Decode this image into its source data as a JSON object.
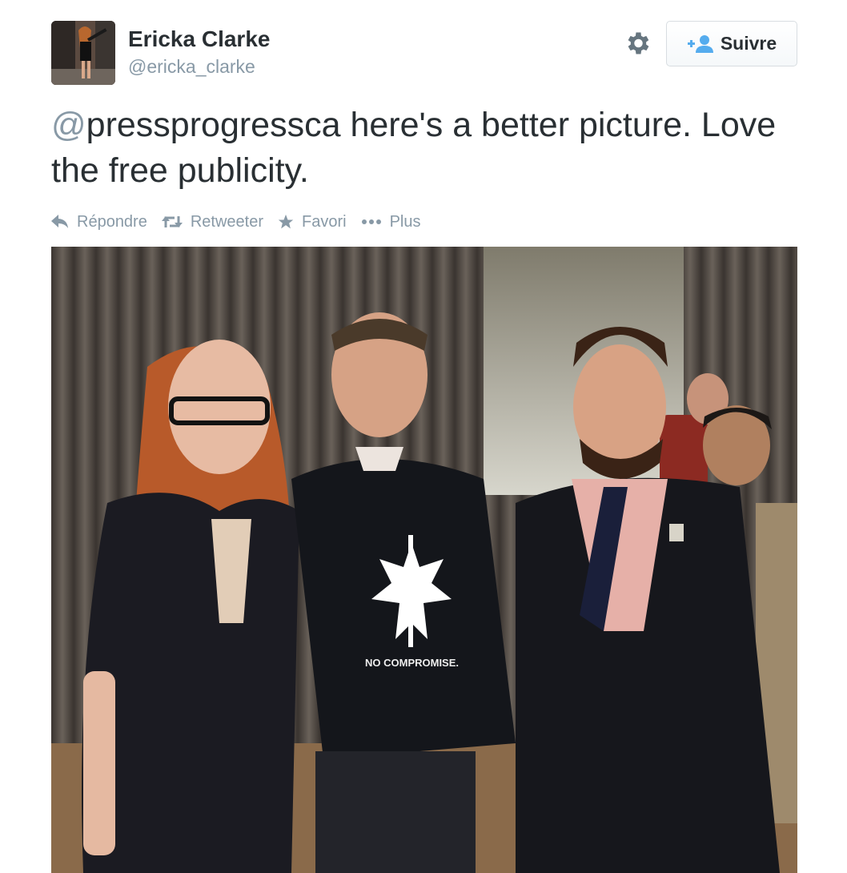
{
  "author": {
    "name": "Ericka Clarke",
    "handle": "@ericka_clarke"
  },
  "follow_button": {
    "label": "Suivre"
  },
  "tweet": {
    "mention_at": "@",
    "mention_name": "pressprogressca",
    "text_rest": " here's a better picture. Love the free publicity."
  },
  "actions": {
    "reply": "Répondre",
    "retweet": "Retweeter",
    "favorite": "Favori",
    "more": "Plus"
  },
  "photo": {
    "shirt_text": "NO COMPROMISE."
  },
  "colors": {
    "text": "#292f33",
    "muted": "#8899a6",
    "follow_icon": "#55acee"
  },
  "icons": {
    "settings": "gear-icon",
    "follow": "add-user-icon",
    "reply": "reply-icon",
    "retweet": "retweet-icon",
    "favorite": "star-icon",
    "more": "ellipsis-icon"
  }
}
